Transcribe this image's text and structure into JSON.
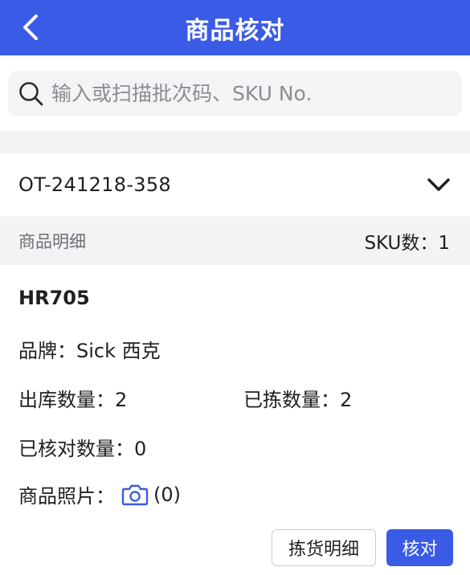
{
  "header": {
    "title": "商品核对",
    "back_icon": "chevron-left-icon"
  },
  "search": {
    "placeholder": "输入或扫描批次码、SKU No.",
    "icon": "search-icon"
  },
  "order": {
    "number": "OT-241218-358",
    "expand_icon": "chevron-down-icon"
  },
  "section": {
    "title": "商品明细",
    "sku_count_label": "SKU数：",
    "sku_count": "1"
  },
  "item": {
    "code": "HR705",
    "brand_label": "品牌：",
    "brand": "Sick 西克",
    "outbound_qty_label": "出库数量：",
    "outbound_qty": "2",
    "picked_qty_label": "已拣数量：",
    "picked_qty": "2",
    "checked_qty_label": "已核对数量：",
    "checked_qty": "0",
    "photo_label": "商品照片：",
    "photo_count": "(0)",
    "photo_icon": "camera-icon"
  },
  "actions": {
    "picking_detail": "拣货明细",
    "verify": "核对"
  },
  "colors": {
    "primary": "#3a5be6",
    "background": "#f2f3f5"
  }
}
